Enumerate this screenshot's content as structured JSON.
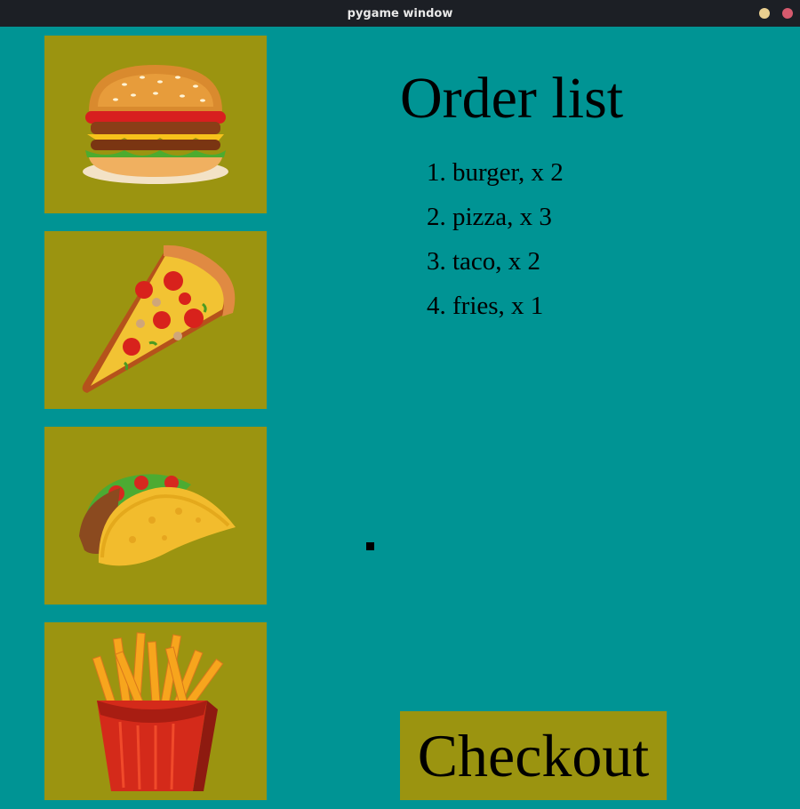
{
  "window": {
    "title": "pygame window"
  },
  "colors": {
    "background": "#009494",
    "tile": "#9b9410",
    "text": "#000000"
  },
  "menu": {
    "items": [
      {
        "name": "burger",
        "icon": "burger-icon"
      },
      {
        "name": "pizza",
        "icon": "pizza-icon"
      },
      {
        "name": "taco",
        "icon": "taco-icon"
      },
      {
        "name": "fries",
        "icon": "fries-icon"
      }
    ]
  },
  "order": {
    "title": "Order list",
    "items": [
      {
        "text": "1. burger, x 2"
      },
      {
        "text": "2. pizza, x 3"
      },
      {
        "text": "3. taco, x 2"
      },
      {
        "text": "4. fries, x 1"
      }
    ]
  },
  "checkout": {
    "label": "Checkout"
  }
}
